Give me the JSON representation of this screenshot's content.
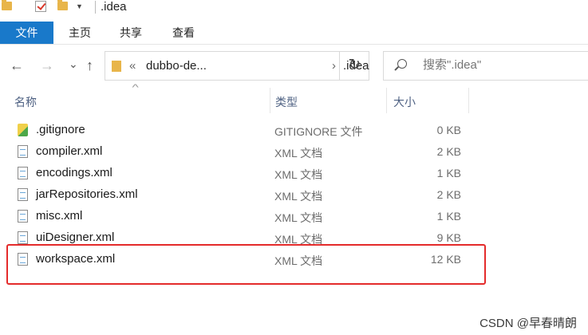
{
  "window": {
    "title": ".idea"
  },
  "ribbon": {
    "tabs": [
      "文件",
      "主页",
      "共享",
      "查看"
    ]
  },
  "nav": {
    "back_icon": "←",
    "forward_icon": "→",
    "recent_icon": "⌄",
    "up_icon": "↑",
    "refresh_icon": "↻",
    "address": {
      "overflow": "«",
      "segment1": "dubbo-de...",
      "sep": "›",
      "segment2": ".idea"
    },
    "search": {
      "placeholder": "搜索\".idea\""
    }
  },
  "columns": {
    "name": "名称",
    "type": "类型",
    "size": "大小"
  },
  "files": [
    {
      "name": ".gitignore",
      "type": "GITIGNORE 文件",
      "size": "0 KB",
      "icon": "gitignore-file-icon"
    },
    {
      "name": "compiler.xml",
      "type": "XML 文档",
      "size": "2 KB",
      "icon": "xml-file-icon"
    },
    {
      "name": "encodings.xml",
      "type": "XML 文档",
      "size": "1 KB",
      "icon": "xml-file-icon"
    },
    {
      "name": "jarRepositories.xml",
      "type": "XML 文档",
      "size": "2 KB",
      "icon": "xml-file-icon"
    },
    {
      "name": "misc.xml",
      "type": "XML 文档",
      "size": "1 KB",
      "icon": "xml-file-icon"
    },
    {
      "name": "uiDesigner.xml",
      "type": "XML 文档",
      "size": "9 KB",
      "icon": "xml-file-icon"
    },
    {
      "name": "workspace.xml",
      "type": "XML 文档",
      "size": "12 KB",
      "icon": "xml-file-icon"
    }
  ],
  "highlight_color": "#e42b2b",
  "accent_color": "#1979ca",
  "watermark": "CSDN @早春晴朗"
}
